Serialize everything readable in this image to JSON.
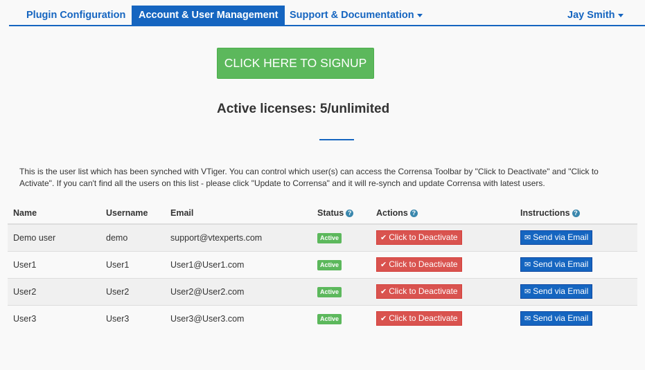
{
  "nav": {
    "tabs": [
      {
        "label": "Plugin Configuration"
      },
      {
        "label": "Account & User Management"
      },
      {
        "label": "Support & Documentation"
      }
    ],
    "user": "Jay Smith"
  },
  "signup_label": "CLICK HERE TO SIGNUP",
  "licenses_text": "Active licenses: 5/unlimited",
  "description": "This is the user list which has been synched with VTiger. You can control which user(s) can access the Corrensa Toolbar by \"Click to Deactivate\" and \"Click to Activate\". If you can't find all the users on this list - please click \"Update to Corrensa\" and it will re-synch and update Corrensa with latest users.",
  "table": {
    "headers": {
      "name": "Name",
      "username": "Username",
      "email": "Email",
      "status": "Status",
      "actions": "Actions",
      "instructions": "Instructions"
    },
    "rows": [
      {
        "name": "Demo user",
        "username": "demo",
        "email": "support@vtexperts.com",
        "status": "Active",
        "action": "Click to Deactivate",
        "instruction": "Send via Email"
      },
      {
        "name": "User1",
        "username": "User1",
        "email": "User1@User1.com",
        "status": "Active",
        "action": "Click to Deactivate",
        "instruction": "Send via Email"
      },
      {
        "name": "User2",
        "username": "User2",
        "email": "User2@User2.com",
        "status": "Active",
        "action": "Click to Deactivate",
        "instruction": "Send via Email"
      },
      {
        "name": "User3",
        "username": "User3",
        "email": "User3@User3.com",
        "status": "Active",
        "action": "Click to Deactivate",
        "instruction": "Send via Email"
      }
    ]
  },
  "icons": {
    "help": "question-circle-icon",
    "check": "check-icon",
    "envelope": "envelope-icon",
    "caret": "caret-down-icon"
  },
  "colors": {
    "primary": "#1565c0",
    "success": "#5cb85c",
    "danger": "#d9534f"
  }
}
